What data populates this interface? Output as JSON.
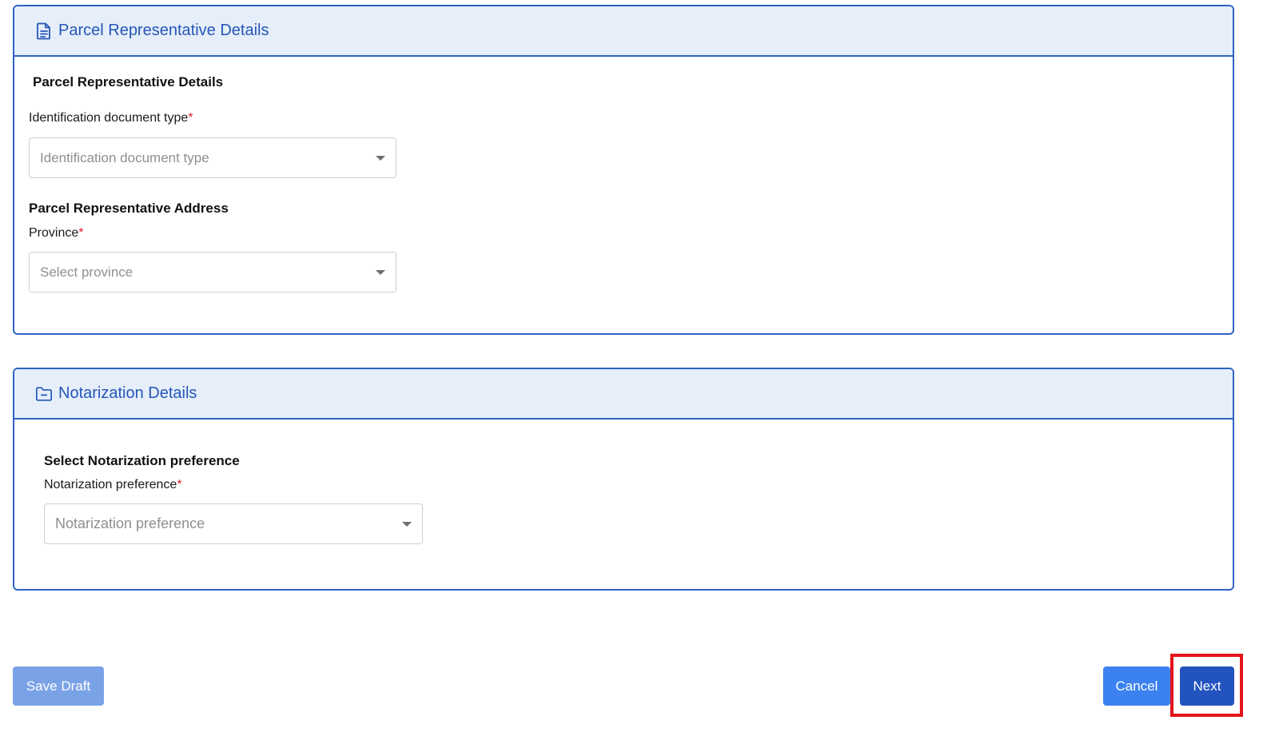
{
  "parcel_card": {
    "header_title": "Parcel Representative Details",
    "header_icon": "document-icon",
    "section_title": "Parcel Representative Details",
    "id_doc_label": "Identification document type",
    "id_doc_placeholder": "Identification document type",
    "address_title": "Parcel Representative Address",
    "province_label": "Province",
    "province_placeholder": "Select province",
    "required_marker": "*"
  },
  "notarization_card": {
    "header_title": "Notarization Details",
    "header_icon": "folder-minus-icon",
    "section_title": "Select Notarization preference",
    "pref_label": "Notarization preference",
    "pref_placeholder": "Notarization preference",
    "required_marker": "*"
  },
  "footer": {
    "save_draft_label": "Save Draft",
    "cancel_label": "Cancel",
    "next_label": "Next"
  },
  "colors": {
    "accent": "#2f63c2",
    "header_bg": "#e5eef9",
    "required": "#d9252a",
    "highlight": "#e4141b"
  }
}
